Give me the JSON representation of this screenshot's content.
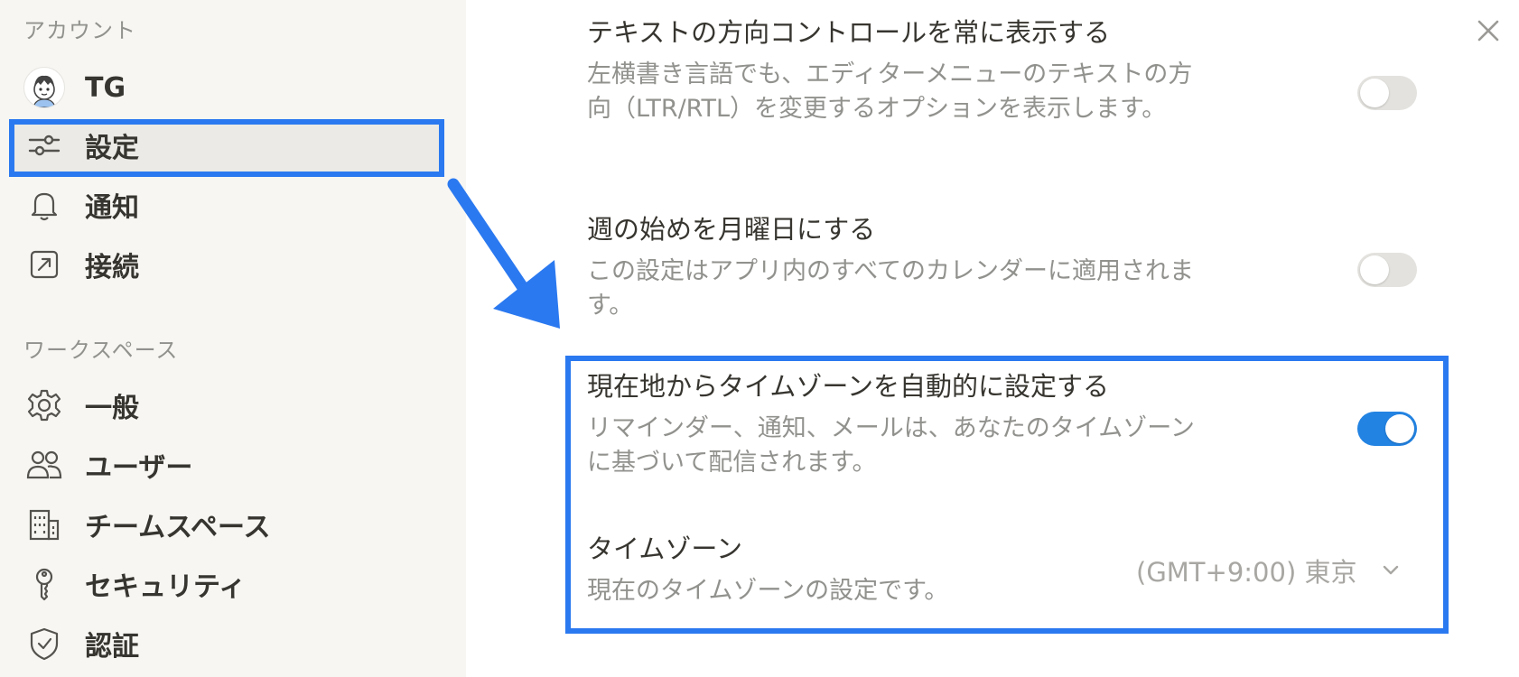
{
  "sidebar": {
    "account_title": "アカウント",
    "user_name": "TG",
    "account_items": [
      {
        "label": "設定",
        "icon": "settings-sliders-icon"
      },
      {
        "label": "通知",
        "icon": "bell-icon"
      },
      {
        "label": "接続",
        "icon": "external-link-icon"
      }
    ],
    "workspace_title": "ワークスペース",
    "workspace_items": [
      {
        "label": "一般",
        "icon": "gear-icon"
      },
      {
        "label": "ユーザー",
        "icon": "users-icon"
      },
      {
        "label": "チームスペース",
        "icon": "building-icon"
      },
      {
        "label": "セキュリティ",
        "icon": "key-icon"
      },
      {
        "label": "認証",
        "icon": "shield-icon"
      }
    ]
  },
  "settings": [
    {
      "title": "テキストの方向コントロールを常に表示する",
      "desc": "左横書き言語でも、エディターメニューのテキストの方向（LTR/RTL）を変更するオプションを表示します。",
      "enabled": false
    },
    {
      "title": "週の始めを月曜日にする",
      "desc": "この設定はアプリ内のすべてのカレンダーに適用されます。",
      "enabled": false
    },
    {
      "title": "現在地からタイムゾーンを自動的に設定する",
      "desc": "リマインダー、通知、メールは、あなたのタイムゾーンに基づいて配信されます。",
      "enabled": true
    }
  ],
  "timezone": {
    "title": "タイムゾーン",
    "desc": "現在のタイムゾーンの設定です。",
    "value": "(GMT+9:00) 東京"
  },
  "colors": {
    "highlight": "#2b79f0",
    "toggle_on": "#2383e2",
    "sidebar_bg": "#f7f6f3"
  }
}
